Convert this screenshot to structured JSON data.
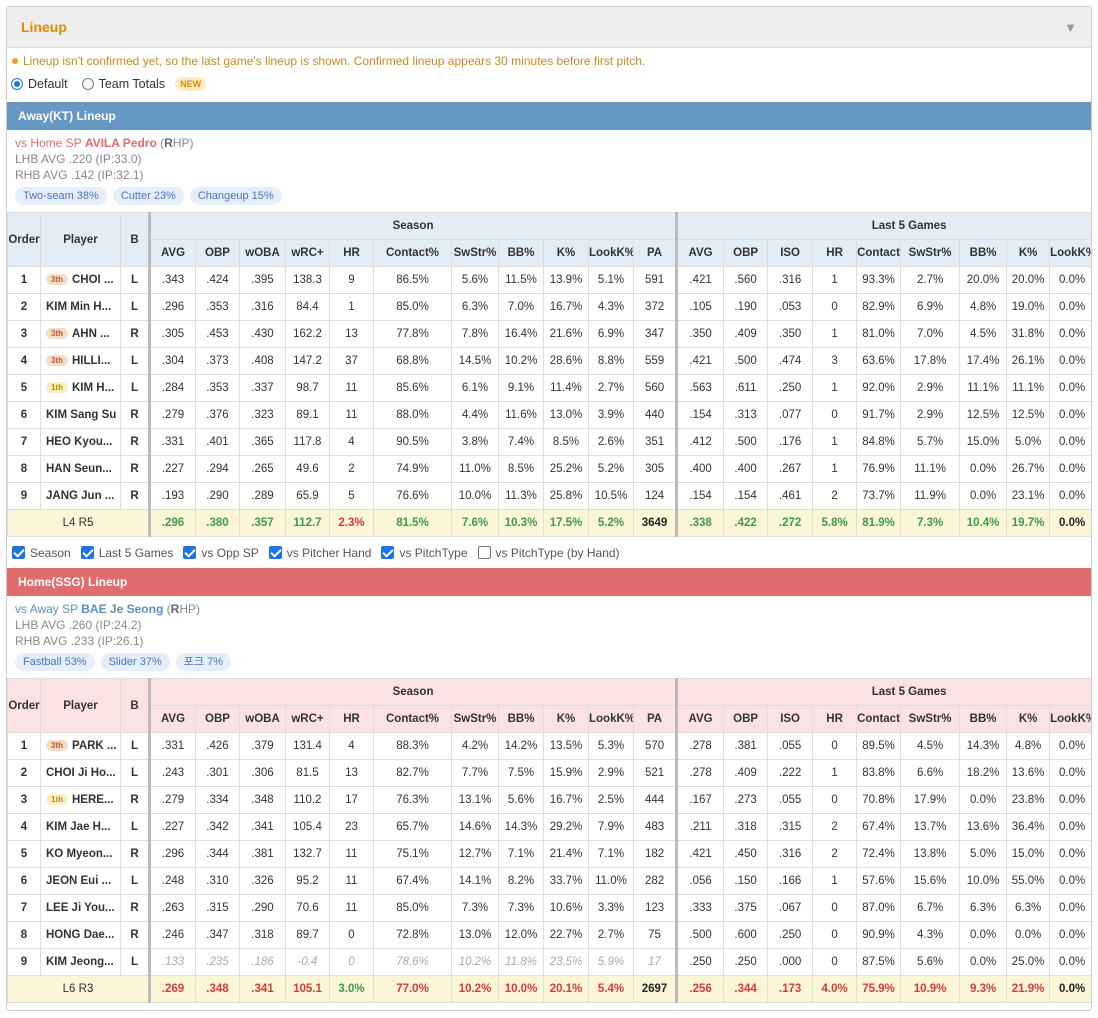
{
  "panel": {
    "title": "Lineup",
    "notice": "Lineup isn't confirmed yet, so the last game's lineup is shown. Confirmed lineup appears 30 minutes before first pitch.",
    "radio_default": "Default",
    "radio_team": "Team Totals",
    "new_badge": "NEW"
  },
  "headers": {
    "order": "Order",
    "player": "Player",
    "b": "B",
    "season": "Season",
    "last5": "Last 5 Games",
    "season_cols": [
      "AVG",
      "OBP",
      "wOBA",
      "wRC+",
      "HR",
      "Contact%",
      "SwStr%",
      "BB%",
      "K%",
      "LookK%",
      "PA"
    ],
    "last5_cols": [
      "AVG",
      "OBP",
      "ISO",
      "HR",
      "Contact%",
      "SwStr%",
      "BB%",
      "K%",
      "LookK%"
    ]
  },
  "away": {
    "title": "Away(KT) Lineup",
    "sp_prefix": "vs Home SP ",
    "sp_name": "AVILA Pedro",
    "sp_hand_open": " (",
    "sp_hand_b": "R",
    "sp_hand_rest": "HP)",
    "lhb": "LHB AVG .220 (IP:33.0)",
    "rhb": "RHB AVG .142 (IP:32.1)",
    "pitches": [
      "Two-seam 38%",
      "Cutter 23%",
      "Changeup 15%"
    ],
    "rows": [
      {
        "o": "1",
        "tag": "3th",
        "name": "CHOI ...",
        "b": "L",
        "s": [
          ".343",
          ".424",
          ".395",
          "138.3",
          "9",
          "86.5%",
          "5.6%",
          "11.5%",
          "13.9%",
          "5.1%",
          "591"
        ],
        "l": [
          ".421",
          ".560",
          ".316",
          "1",
          "93.3%",
          "2.7%",
          "20.0%",
          "20.0%",
          "0.0%"
        ]
      },
      {
        "o": "2",
        "tag": "",
        "name": "KIM Min H...",
        "b": "L",
        "s": [
          ".296",
          ".353",
          ".316",
          "84.4",
          "1",
          "85.0%",
          "6.3%",
          "7.0%",
          "16.7%",
          "4.3%",
          "372"
        ],
        "l": [
          ".105",
          ".190",
          ".053",
          "0",
          "82.9%",
          "6.9%",
          "4.8%",
          "19.0%",
          "0.0%"
        ]
      },
      {
        "o": "3",
        "tag": "3th",
        "name": "AHN ...",
        "b": "R",
        "s": [
          ".305",
          ".453",
          ".430",
          "162.2",
          "13",
          "77.8%",
          "7.8%",
          "16.4%",
          "21.6%",
          "6.9%",
          "347"
        ],
        "l": [
          ".350",
          ".409",
          ".350",
          "1",
          "81.0%",
          "7.0%",
          "4.5%",
          "31.8%",
          "0.0%"
        ]
      },
      {
        "o": "4",
        "tag": "3th",
        "name": "HILLI...",
        "b": "L",
        "s": [
          ".304",
          ".373",
          ".408",
          "147.2",
          "37",
          "68.8%",
          "14.5%",
          "10.2%",
          "28.6%",
          "8.8%",
          "559"
        ],
        "l": [
          ".421",
          ".500",
          ".474",
          "3",
          "63.6%",
          "17.8%",
          "17.4%",
          "26.1%",
          "0.0%"
        ]
      },
      {
        "o": "5",
        "tag": "1th",
        "name": "KIM H...",
        "b": "L",
        "s": [
          ".284",
          ".353",
          ".337",
          "98.7",
          "11",
          "85.6%",
          "6.1%",
          "9.1%",
          "11.4%",
          "2.7%",
          "560"
        ],
        "l": [
          ".563",
          ".611",
          ".250",
          "1",
          "92.0%",
          "2.9%",
          "11.1%",
          "11.1%",
          "0.0%"
        ]
      },
      {
        "o": "6",
        "tag": "",
        "name": "KIM Sang Su",
        "b": "R",
        "s": [
          ".279",
          ".376",
          ".323",
          "89.1",
          "11",
          "88.0%",
          "4.4%",
          "11.6%",
          "13.0%",
          "3.9%",
          "440"
        ],
        "l": [
          ".154",
          ".313",
          ".077",
          "0",
          "91.7%",
          "2.9%",
          "12.5%",
          "12.5%",
          "0.0%"
        ]
      },
      {
        "o": "7",
        "tag": "",
        "name": "HEO Kyou...",
        "b": "R",
        "s": [
          ".331",
          ".401",
          ".365",
          "117.8",
          "4",
          "90.5%",
          "3.8%",
          "7.4%",
          "8.5%",
          "2.6%",
          "351"
        ],
        "l": [
          ".412",
          ".500",
          ".176",
          "1",
          "84.8%",
          "5.7%",
          "15.0%",
          "5.0%",
          "0.0%"
        ]
      },
      {
        "o": "8",
        "tag": "",
        "name": "HAN Seun...",
        "b": "R",
        "s": [
          ".227",
          ".294",
          ".265",
          "49.6",
          "2",
          "74.9%",
          "11.0%",
          "8.5%",
          "25.2%",
          "5.2%",
          "305"
        ],
        "l": [
          ".400",
          ".400",
          ".267",
          "1",
          "76.9%",
          "11.1%",
          "0.0%",
          "26.7%",
          "0.0%"
        ]
      },
      {
        "o": "9",
        "tag": "",
        "name": "JANG Jun ...",
        "b": "R",
        "s": [
          ".193",
          ".290",
          ".289",
          "65.9",
          "5",
          "76.6%",
          "10.0%",
          "11.3%",
          "25.8%",
          "10.5%",
          "124"
        ],
        "l": [
          ".154",
          ".154",
          ".461",
          "2",
          "73.7%",
          "11.9%",
          "0.0%",
          "23.1%",
          "0.0%"
        ]
      }
    ],
    "total": {
      "lr_a": "L4 R",
      "lr_b": "5",
      "s": [
        ".296",
        ".380",
        ".357",
        "112.7",
        "2.3%",
        "81.5%",
        "7.6%",
        "10.3%",
        "17.5%",
        "5.2%",
        "3649"
      ],
      "sc": [
        "g",
        "g",
        "g",
        "g",
        "rd",
        "g",
        "g",
        "g",
        "g",
        "g",
        "k"
      ],
      "l": [
        ".338",
        ".422",
        ".272",
        "5.8%",
        "81.9%",
        "7.3%",
        "10.4%",
        "19.7%",
        "0.0%"
      ],
      "lc": [
        "g",
        "g",
        "g",
        "g",
        "g",
        "g",
        "g",
        "g",
        "k"
      ]
    }
  },
  "checks": [
    {
      "label": "Season",
      "on": true
    },
    {
      "label": "Last 5 Games",
      "on": true
    },
    {
      "label": "vs Opp SP",
      "on": true
    },
    {
      "label": "vs Pitcher Hand",
      "on": true
    },
    {
      "label": "vs PitchType",
      "on": true
    },
    {
      "label": "vs PitchType (by Hand)",
      "on": false
    }
  ],
  "home": {
    "title": "Home(SSG) Lineup",
    "sp_prefix": "vs Away SP ",
    "sp_name": "BAE Je Seong",
    "sp_hand_open": " (",
    "sp_hand_b": "R",
    "sp_hand_rest": "HP)",
    "lhb": "LHB AVG .260 (IP:24.2)",
    "rhb": "RHB AVG .233 (IP:26.1)",
    "pitches": [
      "Fastball 53%",
      "Slider 37%",
      "포크 7%"
    ],
    "rows": [
      {
        "o": "1",
        "tag": "3th",
        "name": "PARK ...",
        "b": "L",
        "s": [
          ".331",
          ".426",
          ".379",
          "131.4",
          "4",
          "88.3%",
          "4.2%",
          "14.2%",
          "13.5%",
          "5.3%",
          "570"
        ],
        "l": [
          ".278",
          ".381",
          ".055",
          "0",
          "89.5%",
          "4.5%",
          "14.3%",
          "4.8%",
          "0.0%"
        ]
      },
      {
        "o": "2",
        "tag": "",
        "name": "CHOI Ji Ho...",
        "b": "L",
        "s": [
          ".243",
          ".301",
          ".306",
          "81.5",
          "13",
          "82.7%",
          "7.7%",
          "7.5%",
          "15.9%",
          "2.9%",
          "521"
        ],
        "l": [
          ".278",
          ".409",
          ".222",
          "1",
          "83.8%",
          "6.6%",
          "18.2%",
          "13.6%",
          "0.0%"
        ]
      },
      {
        "o": "3",
        "tag": "1th",
        "name": "HERE...",
        "b": "R",
        "s": [
          ".279",
          ".334",
          ".348",
          "110.2",
          "17",
          "76.3%",
          "13.1%",
          "5.6%",
          "16.7%",
          "2.5%",
          "444"
        ],
        "l": [
          ".167",
          ".273",
          ".055",
          "0",
          "70.8%",
          "17.9%",
          "0.0%",
          "23.8%",
          "0.0%"
        ]
      },
      {
        "o": "4",
        "tag": "",
        "name": "KIM Jae H...",
        "b": "L",
        "s": [
          ".227",
          ".342",
          ".341",
          "105.4",
          "23",
          "65.7%",
          "14.6%",
          "14.3%",
          "29.2%",
          "7.9%",
          "483"
        ],
        "l": [
          ".211",
          ".318",
          ".315",
          "2",
          "67.4%",
          "13.7%",
          "13.6%",
          "36.4%",
          "0.0%"
        ]
      },
      {
        "o": "5",
        "tag": "",
        "name": "KO Myeon...",
        "b": "R",
        "s": [
          ".296",
          ".344",
          ".381",
          "132.7",
          "11",
          "75.1%",
          "12.7%",
          "7.1%",
          "21.4%",
          "7.1%",
          "182"
        ],
        "l": [
          ".421",
          ".450",
          ".316",
          "2",
          "72.4%",
          "13.8%",
          "5.0%",
          "15.0%",
          "0.0%"
        ]
      },
      {
        "o": "6",
        "tag": "",
        "name": "JEON Eui ...",
        "b": "L",
        "s": [
          ".248",
          ".310",
          ".326",
          "95.2",
          "11",
          "67.4%",
          "14.1%",
          "8.2%",
          "33.7%",
          "11.0%",
          "282"
        ],
        "l": [
          ".056",
          ".150",
          ".166",
          "1",
          "57.6%",
          "15.6%",
          "10.0%",
          "55.0%",
          "0.0%"
        ]
      },
      {
        "o": "7",
        "tag": "",
        "name": "LEE Ji You...",
        "b": "R",
        "s": [
          ".263",
          ".315",
          ".290",
          "70.6",
          "11",
          "85.0%",
          "7.3%",
          "7.3%",
          "10.6%",
          "3.3%",
          "123"
        ],
        "l": [
          ".333",
          ".375",
          ".067",
          "0",
          "87.0%",
          "6.7%",
          "6.3%",
          "6.3%",
          "0.0%"
        ]
      },
      {
        "o": "8",
        "tag": "",
        "name": "HONG Dae...",
        "b": "R",
        "s": [
          ".246",
          ".347",
          ".318",
          "89.7",
          "0",
          "72.8%",
          "13.0%",
          "12.0%",
          "22.7%",
          "2.7%",
          "75"
        ],
        "l": [
          ".500",
          ".600",
          ".250",
          "0",
          "90.9%",
          "4.3%",
          "0.0%",
          "0.0%",
          "0.0%"
        ]
      },
      {
        "o": "9",
        "tag": "",
        "name": "KIM Jeong...",
        "b": "L",
        "dim": true,
        "s": [
          ".133",
          ".235",
          ".186",
          "-0.4",
          "0",
          "78.6%",
          "10.2%",
          "11.8%",
          "23.5%",
          "5.9%",
          "17"
        ],
        "l": [
          ".250",
          ".250",
          ".000",
          "0",
          "87.5%",
          "5.6%",
          "0.0%",
          "25.0%",
          "0.0%"
        ]
      }
    ],
    "total": {
      "lr_a": "L6 R",
      "lr_b": "3",
      "s": [
        ".269",
        ".348",
        ".341",
        "105.1",
        "3.0%",
        "77.0%",
        "10.2%",
        "10.0%",
        "20.1%",
        "5.4%",
        "2697"
      ],
      "sc": [
        "rd",
        "rd",
        "rd",
        "rd",
        "g",
        "rd",
        "rd",
        "rd",
        "rd",
        "rd",
        "k"
      ],
      "l": [
        ".256",
        ".344",
        ".173",
        "4.0%",
        "75.9%",
        "10.9%",
        "9.3%",
        "21.9%",
        "0.0%"
      ],
      "lc": [
        "rd",
        "rd",
        "rd",
        "rd",
        "rd",
        "rd",
        "rd",
        "rd",
        "k"
      ]
    }
  }
}
